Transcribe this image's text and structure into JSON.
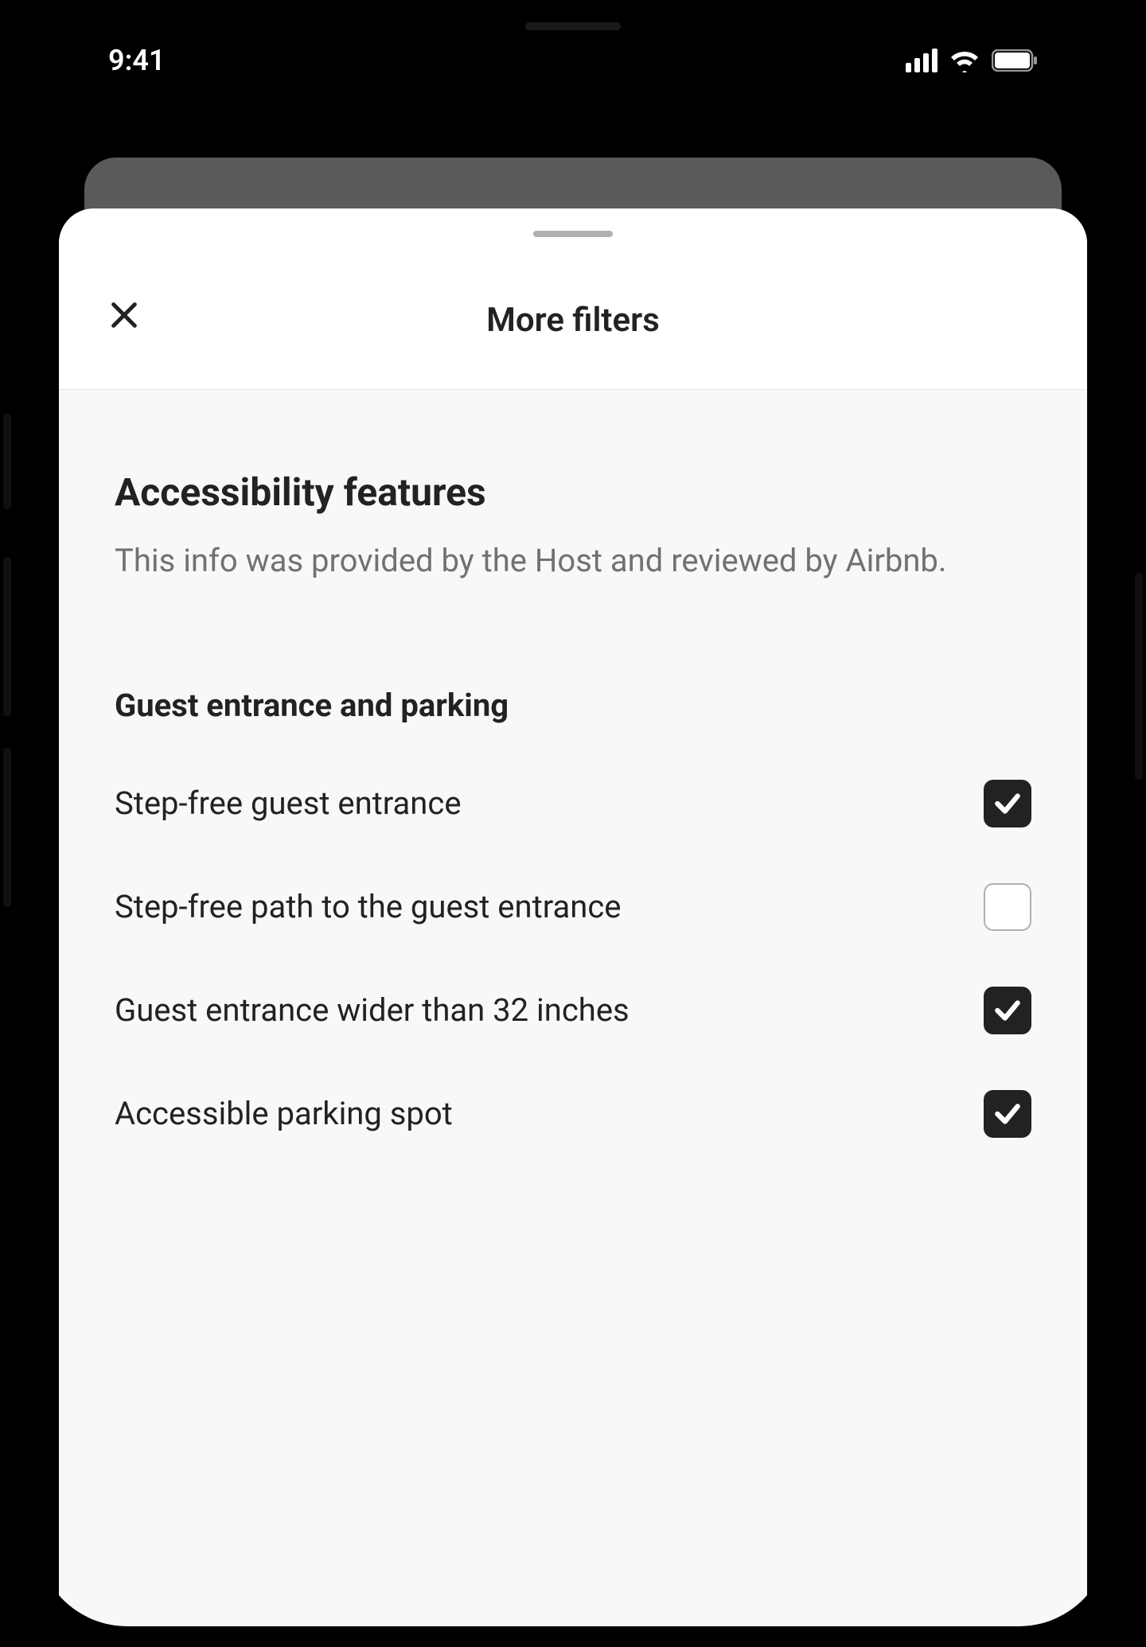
{
  "statusBar": {
    "time": "9:41"
  },
  "sheet": {
    "title": "More filters",
    "section": {
      "title": "Accessibility features",
      "description": "This info was provided by the Host and reviewed by Airbnb."
    },
    "subsection": {
      "title": "Guest entrance and parking",
      "items": [
        {
          "label": "Step-free guest entrance",
          "checked": true
        },
        {
          "label": "Step-free path to the guest entrance",
          "checked": false
        },
        {
          "label": "Guest entrance wider than 32 inches",
          "checked": true
        },
        {
          "label": "Accessible parking spot",
          "checked": true
        }
      ]
    }
  }
}
